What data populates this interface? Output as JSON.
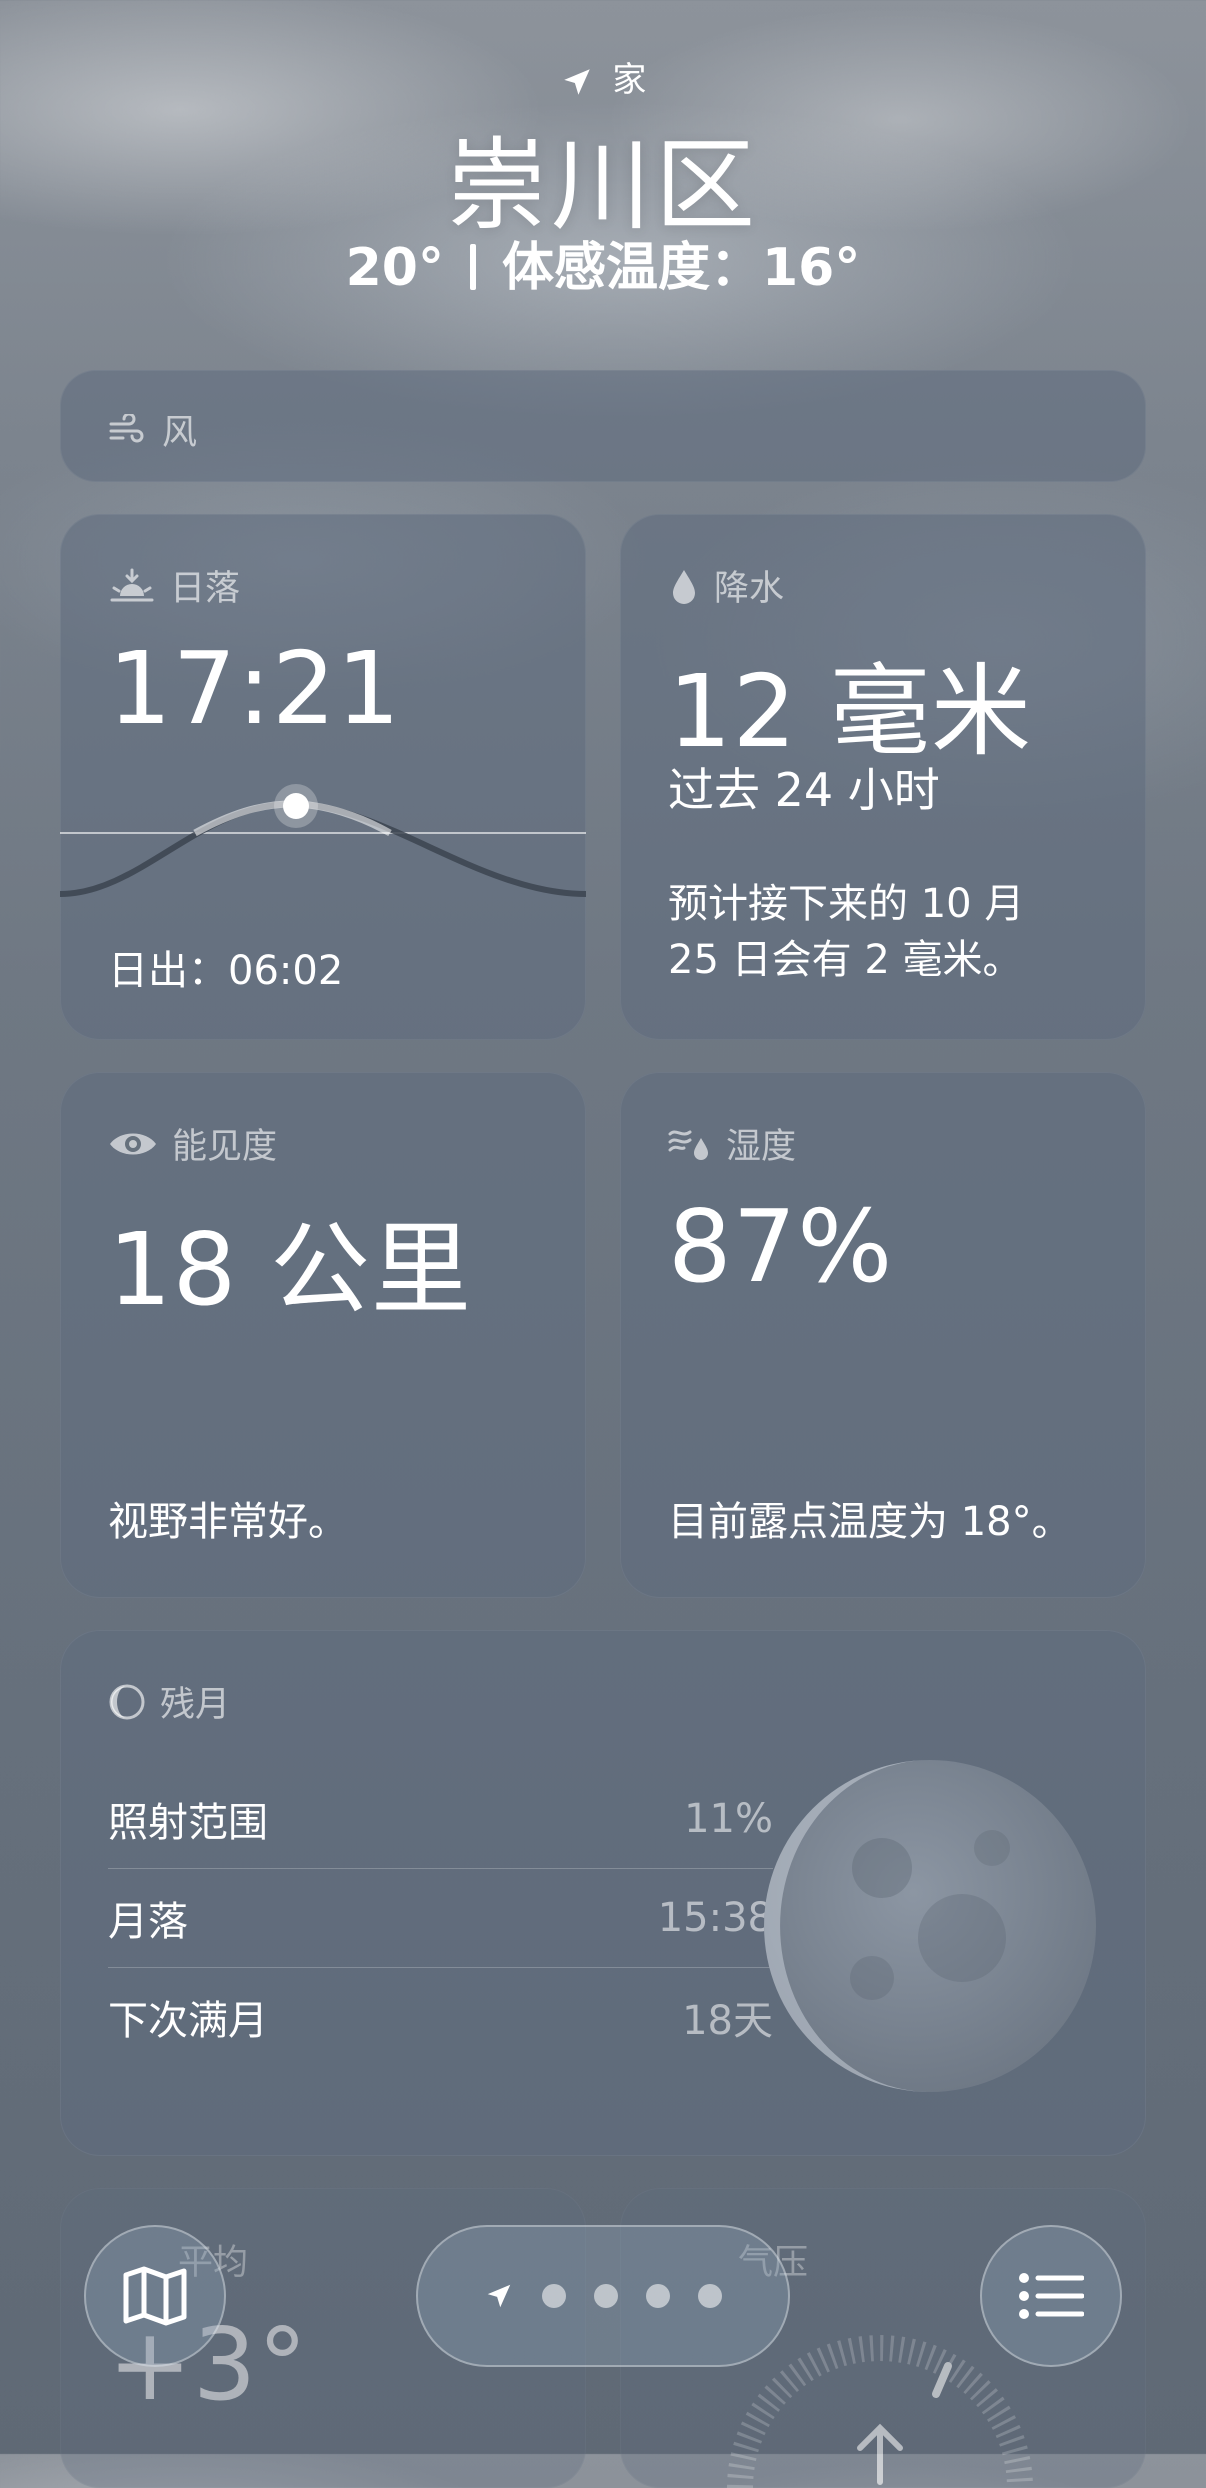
{
  "header": {
    "location_label": "家",
    "city": "崇川区",
    "temperature": "20°",
    "feels_like": "体感温度：16°"
  },
  "wind": {
    "title": "风"
  },
  "sunset": {
    "title": "日落",
    "time": "17:21",
    "sunrise": "日出：06:02"
  },
  "precipitation": {
    "title": "降水",
    "amount": "12 毫米",
    "period": "过去 24 小时",
    "forecast_line1": "预计接下来的 10 月",
    "forecast_line2": "25 日会有 2 毫米。"
  },
  "visibility": {
    "title": "能见度",
    "value": "18 公里",
    "description": "视野非常好。"
  },
  "humidity": {
    "title": "湿度",
    "value": "87%",
    "description": "目前露点温度为 18°。"
  },
  "moon": {
    "title": "残月",
    "rows": [
      {
        "label": "照射范围",
        "value": "11%"
      },
      {
        "label": "月落",
        "value": "15:38"
      },
      {
        "label": "下次满月",
        "value": "18天"
      }
    ],
    "illumination": 0.11
  },
  "bottom_cards": {
    "left_title": "平均",
    "left_value": "+3°",
    "right_title": "气压"
  },
  "nav": {
    "page_count": 4,
    "icons": [
      "map-icon",
      "location-arrow-icon",
      "list-icon"
    ]
  },
  "colors": {
    "card_bg": "#5f6c7d",
    "text": "#ffffff"
  }
}
